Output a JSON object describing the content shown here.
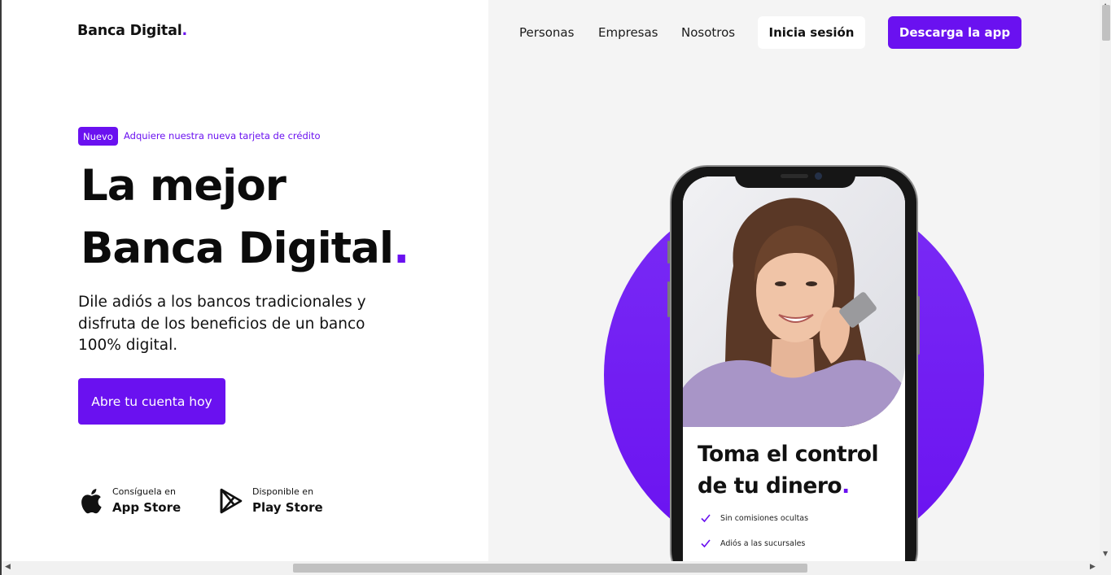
{
  "header": {
    "logo_text": "Banca Digital",
    "logo_dot": ".",
    "nav": [
      "Personas",
      "Empresas",
      "Nosotros"
    ],
    "login_label": "Inicia sesión",
    "download_label": "Descarga la app"
  },
  "hero": {
    "badge": "Nuevo",
    "badge_link": "Adquiere nuestra nueva tarjeta de crédito",
    "headline_line1": "La mejor",
    "headline_line2": "Banca Digital",
    "headline_dot": ".",
    "subtext": "Dile adiós a los bancos tradicionales y disfruta de los beneficios de un banco 100% digital.",
    "cta_label": "Abre tu cuenta hoy"
  },
  "stores": [
    {
      "small": "Consíguela en",
      "big": "App Store",
      "icon": "apple-icon"
    },
    {
      "small": "Disponible en",
      "big": "Play Store",
      "icon": "play-store-icon"
    }
  ],
  "phone": {
    "title_line1": "Toma el control",
    "title_line2": "de tu dinero",
    "title_dot": ".",
    "features": [
      "Sin comisiones ocultas",
      "Adiós a las sucursales"
    ]
  },
  "colors": {
    "accent": "#6a11f0",
    "panel": "#f4f4f4",
    "text": "#111111"
  }
}
